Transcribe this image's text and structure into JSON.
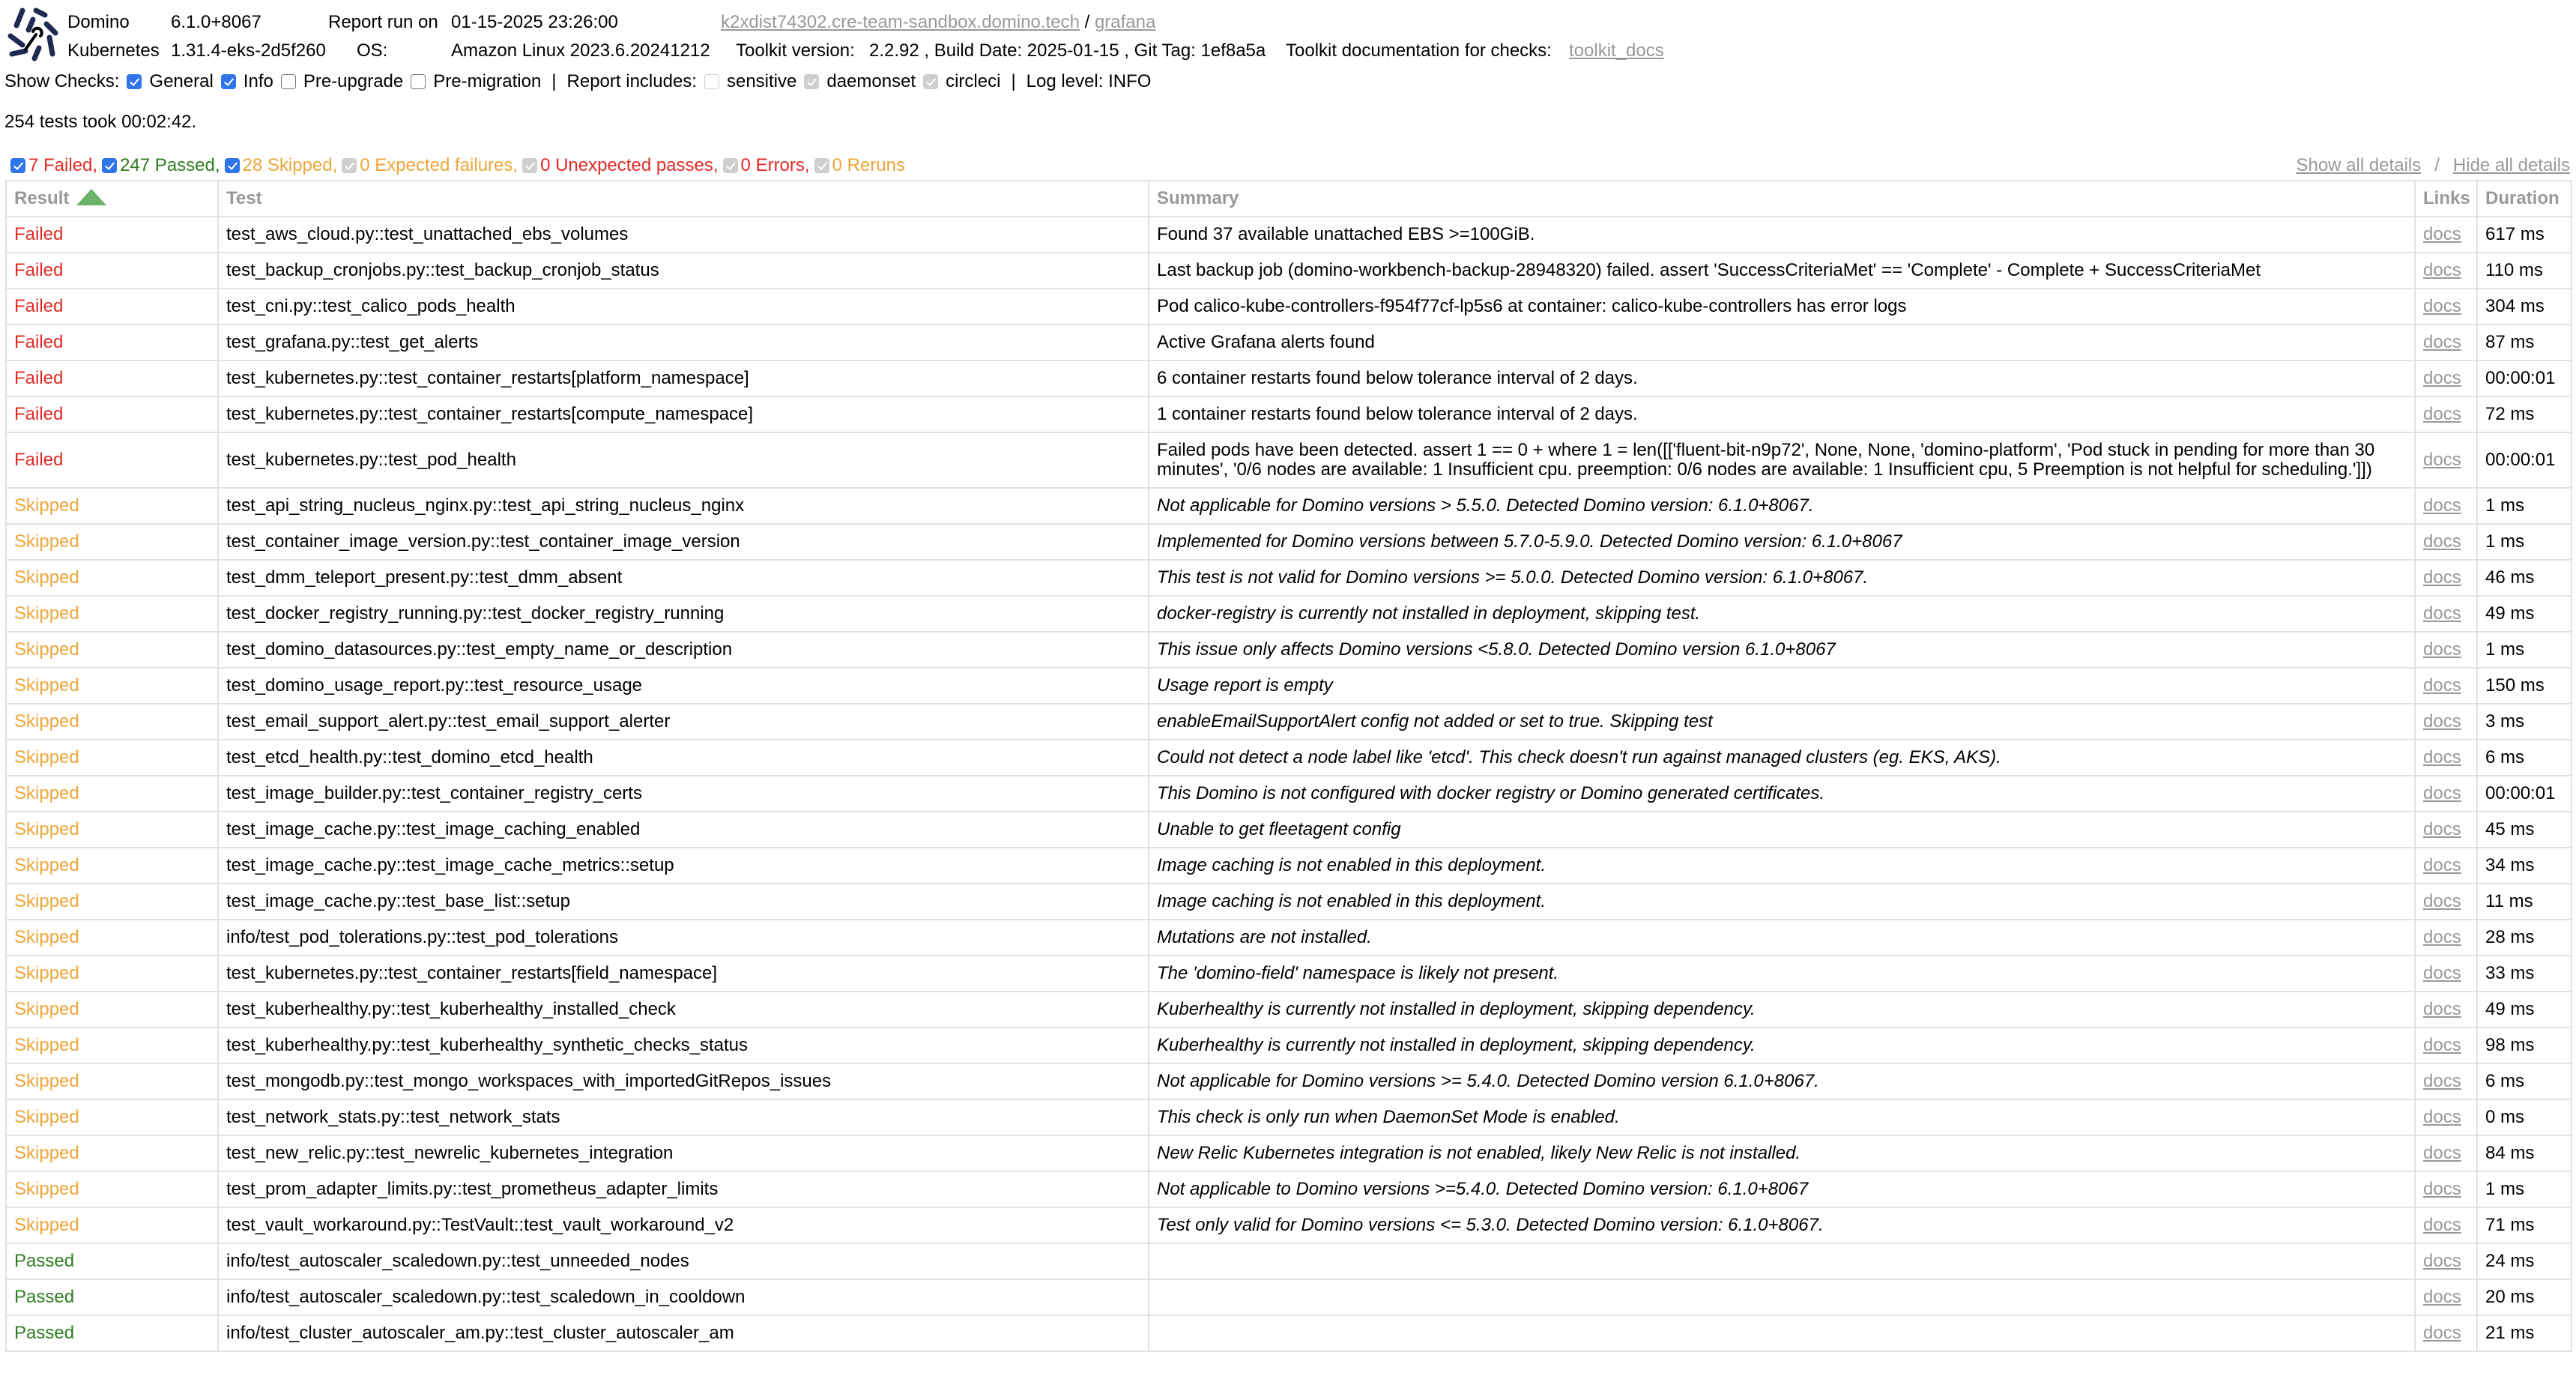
{
  "header": {
    "product_label": "Domino",
    "product_version": "6.1.0+8067",
    "report_run_label": "Report run on",
    "report_run_value": "01-15-2025 23:26:00",
    "host_link": "k2xdist74302.cre-team-sandbox.domino.tech",
    "host_sep": "/",
    "grafana_link": "grafana",
    "kubernetes_label": "Kubernetes",
    "kubernetes_version": "1.31.4-eks-2d5f260",
    "os_label": "OS:",
    "os_value": "Amazon Linux 2023.6.20241212",
    "toolkit_label": "Toolkit version:",
    "toolkit_value": "2.2.92 , Build Date: 2025-01-15 , Git Tag: 1ef8a5a",
    "toolkit_docs_label": "Toolkit documentation for checks:",
    "toolkit_docs_link": "toolkit_docs"
  },
  "checks": {
    "show_label": "Show Checks:",
    "items": [
      {
        "label": "General",
        "checked": true
      },
      {
        "label": "Info",
        "checked": true
      },
      {
        "label": "Pre-upgrade",
        "checked": false
      },
      {
        "label": "Pre-migration",
        "checked": false
      }
    ],
    "sep": "|",
    "includes_label": "Report includes:",
    "includes": [
      {
        "label": "sensitive",
        "checked": false
      },
      {
        "label": "daemonset",
        "checked": true
      },
      {
        "label": "circleci",
        "checked": true
      }
    ],
    "log_level": "Log level: INFO"
  },
  "summary_text": "254 tests took 00:02:42.",
  "filters": [
    {
      "label": "7 Failed,",
      "checked": true,
      "enabled": true,
      "color": "#e02b27"
    },
    {
      "label": "247 Passed,",
      "checked": true,
      "enabled": true,
      "color": "#2f7d1f"
    },
    {
      "label": "28 Skipped,",
      "checked": true,
      "enabled": true,
      "color": "#eea63a"
    },
    {
      "label": "0 Expected failures,",
      "checked": true,
      "enabled": false,
      "color": "#eea63a"
    },
    {
      "label": "0 Unexpected passes,",
      "checked": true,
      "enabled": false,
      "color": "#e02b27"
    },
    {
      "label": "0 Errors,",
      "checked": true,
      "enabled": false,
      "color": "#e02b27"
    },
    {
      "label": "0 Reruns",
      "checked": true,
      "enabled": false,
      "color": "#eea63a"
    }
  ],
  "details": {
    "show_all": "Show all details",
    "sep": "/",
    "hide_all": "Hide all details"
  },
  "table": {
    "columns": [
      "Result",
      "Test",
      "Summary",
      "Links",
      "Duration"
    ],
    "sort_column": "Result",
    "rows": [
      {
        "result": "Failed",
        "test": "test_aws_cloud.py::test_unattached_ebs_volumes",
        "summary": "Found 37 available unattached EBS >=100GiB.",
        "link": "docs",
        "duration": "617 ms"
      },
      {
        "result": "Failed",
        "test": "test_backup_cronjobs.py::test_backup_cronjob_status",
        "summary": "Last backup job (domino-workbench-backup-28948320) failed. assert 'SuccessCriteriaMet' == 'Complete' - Complete + SuccessCriteriaMet",
        "link": "docs",
        "duration": "110 ms"
      },
      {
        "result": "Failed",
        "test": "test_cni.py::test_calico_pods_health",
        "summary": "Pod calico-kube-controllers-f954f77cf-lp5s6 at container: calico-kube-controllers has error logs",
        "link": "docs",
        "duration": "304 ms"
      },
      {
        "result": "Failed",
        "test": "test_grafana.py::test_get_alerts",
        "summary": "Active Grafana alerts found",
        "link": "docs",
        "duration": "87 ms"
      },
      {
        "result": "Failed",
        "test": "test_kubernetes.py::test_container_restarts[platform_namespace]",
        "summary": "6 container restarts found below tolerance interval of 2 days.",
        "link": "docs",
        "duration": "00:00:01"
      },
      {
        "result": "Failed",
        "test": "test_kubernetes.py::test_container_restarts[compute_namespace]",
        "summary": "1 container restarts found below tolerance interval of 2 days.",
        "link": "docs",
        "duration": "72 ms"
      },
      {
        "result": "Failed",
        "test": "test_kubernetes.py::test_pod_health",
        "summary": "Failed pods have been detected. assert 1 == 0 + where 1 = len([['fluent-bit-n9p72', None, None, 'domino-platform', 'Pod stuck in pending for more than 30 minutes', '0/6 nodes are available: 1 Insufficient cpu. preemption: 0/6 nodes are available: 1 Insufficient cpu, 5 Preemption is not helpful for scheduling.']])",
        "link": "docs",
        "duration": "00:00:01"
      },
      {
        "result": "Skipped",
        "test": "test_api_string_nucleus_nginx.py::test_api_string_nucleus_nginx",
        "summary": "Not applicable for Domino versions > 5.5.0. Detected Domino version: 6.1.0+8067.",
        "link": "docs",
        "duration": "1 ms"
      },
      {
        "result": "Skipped",
        "test": "test_container_image_version.py::test_container_image_version",
        "summary": "Implemented for Domino versions between 5.7.0-5.9.0. Detected Domino version: 6.1.0+8067",
        "link": "docs",
        "duration": "1 ms"
      },
      {
        "result": "Skipped",
        "test": "test_dmm_teleport_present.py::test_dmm_absent",
        "summary": "This test is not valid for Domino versions >= 5.0.0. Detected Domino version: 6.1.0+8067.",
        "link": "docs",
        "duration": "46 ms"
      },
      {
        "result": "Skipped",
        "test": "test_docker_registry_running.py::test_docker_registry_running",
        "summary": "docker-registry is currently not installed in deployment, skipping test.",
        "link": "docs",
        "duration": "49 ms"
      },
      {
        "result": "Skipped",
        "test": "test_domino_datasources.py::test_empty_name_or_description",
        "summary": "This issue only affects Domino versions <5.8.0. Detected Domino version 6.1.0+8067",
        "link": "docs",
        "duration": "1 ms"
      },
      {
        "result": "Skipped",
        "test": "test_domino_usage_report.py::test_resource_usage",
        "summary": "Usage report is empty",
        "link": "docs",
        "duration": "150 ms"
      },
      {
        "result": "Skipped",
        "test": "test_email_support_alert.py::test_email_support_alerter",
        "summary": "enableEmailSupportAlert config not added or set to true. Skipping test",
        "link": "docs",
        "duration": "3 ms"
      },
      {
        "result": "Skipped",
        "test": "test_etcd_health.py::test_domino_etcd_health",
        "summary": "Could not detect a node label like 'etcd'. This check doesn't run against managed clusters (eg. EKS, AKS).",
        "link": "docs",
        "duration": "6 ms"
      },
      {
        "result": "Skipped",
        "test": "test_image_builder.py::test_container_registry_certs",
        "summary": "This Domino is not configured with docker registry or Domino generated certificates.",
        "link": "docs",
        "duration": "00:00:01"
      },
      {
        "result": "Skipped",
        "test": "test_image_cache.py::test_image_caching_enabled",
        "summary": "Unable to get fleetagent config",
        "link": "docs",
        "duration": "45 ms"
      },
      {
        "result": "Skipped",
        "test": "test_image_cache.py::test_image_cache_metrics::setup",
        "summary": "Image caching is not enabled in this deployment.",
        "link": "docs",
        "duration": "34 ms"
      },
      {
        "result": "Skipped",
        "test": "test_image_cache.py::test_base_list::setup",
        "summary": "Image caching is not enabled in this deployment.",
        "link": "docs",
        "duration": "11 ms"
      },
      {
        "result": "Skipped",
        "test": "info/test_pod_tolerations.py::test_pod_tolerations",
        "summary": "Mutations are not installed.",
        "link": "docs",
        "duration": "28 ms"
      },
      {
        "result": "Skipped",
        "test": "test_kubernetes.py::test_container_restarts[field_namespace]",
        "summary": "The 'domino-field' namespace is likely not present.",
        "link": "docs",
        "duration": "33 ms"
      },
      {
        "result": "Skipped",
        "test": "test_kuberhealthy.py::test_kuberhealthy_installed_check",
        "summary": "Kuberhealthy is currently not installed in deployment, skipping dependency.",
        "link": "docs",
        "duration": "49 ms"
      },
      {
        "result": "Skipped",
        "test": "test_kuberhealthy.py::test_kuberhealthy_synthetic_checks_status",
        "summary": "Kuberhealthy is currently not installed in deployment, skipping dependency.",
        "link": "docs",
        "duration": "98 ms"
      },
      {
        "result": "Skipped",
        "test": "test_mongodb.py::test_mongo_workspaces_with_importedGitRepos_issues",
        "summary": "Not applicable for Domino versions >= 5.4.0. Detected Domino version 6.1.0+8067.",
        "link": "docs",
        "duration": "6 ms"
      },
      {
        "result": "Skipped",
        "test": "test_network_stats.py::test_network_stats",
        "summary": "This check is only run when DaemonSet Mode is enabled.",
        "link": "docs",
        "duration": "0 ms"
      },
      {
        "result": "Skipped",
        "test": "test_new_relic.py::test_newrelic_kubernetes_integration",
        "summary": "New Relic Kubernetes integration is not enabled, likely New Relic is not installed.",
        "link": "docs",
        "duration": "84 ms"
      },
      {
        "result": "Skipped",
        "test": "test_prom_adapter_limits.py::test_prometheus_adapter_limits",
        "summary": "Not applicable to Domino versions >=5.4.0. Detected Domino version: 6.1.0+8067",
        "link": "docs",
        "duration": "1 ms"
      },
      {
        "result": "Skipped",
        "test": "test_vault_workaround.py::TestVault::test_vault_workaround_v2",
        "summary": "Test only valid for Domino versions <= 5.3.0. Detected Domino version: 6.1.0+8067.",
        "link": "docs",
        "duration": "71 ms"
      },
      {
        "result": "Passed",
        "test": "info/test_autoscaler_scaledown.py::test_unneeded_nodes",
        "summary": "",
        "link": "docs",
        "duration": "24 ms"
      },
      {
        "result": "Passed",
        "test": "info/test_autoscaler_scaledown.py::test_scaledown_in_cooldown",
        "summary": "",
        "link": "docs",
        "duration": "20 ms"
      },
      {
        "result": "Passed",
        "test": "info/test_cluster_autoscaler_am.py::test_cluster_autoscaler_am",
        "summary": "",
        "link": "docs",
        "duration": "21 ms"
      }
    ]
  }
}
